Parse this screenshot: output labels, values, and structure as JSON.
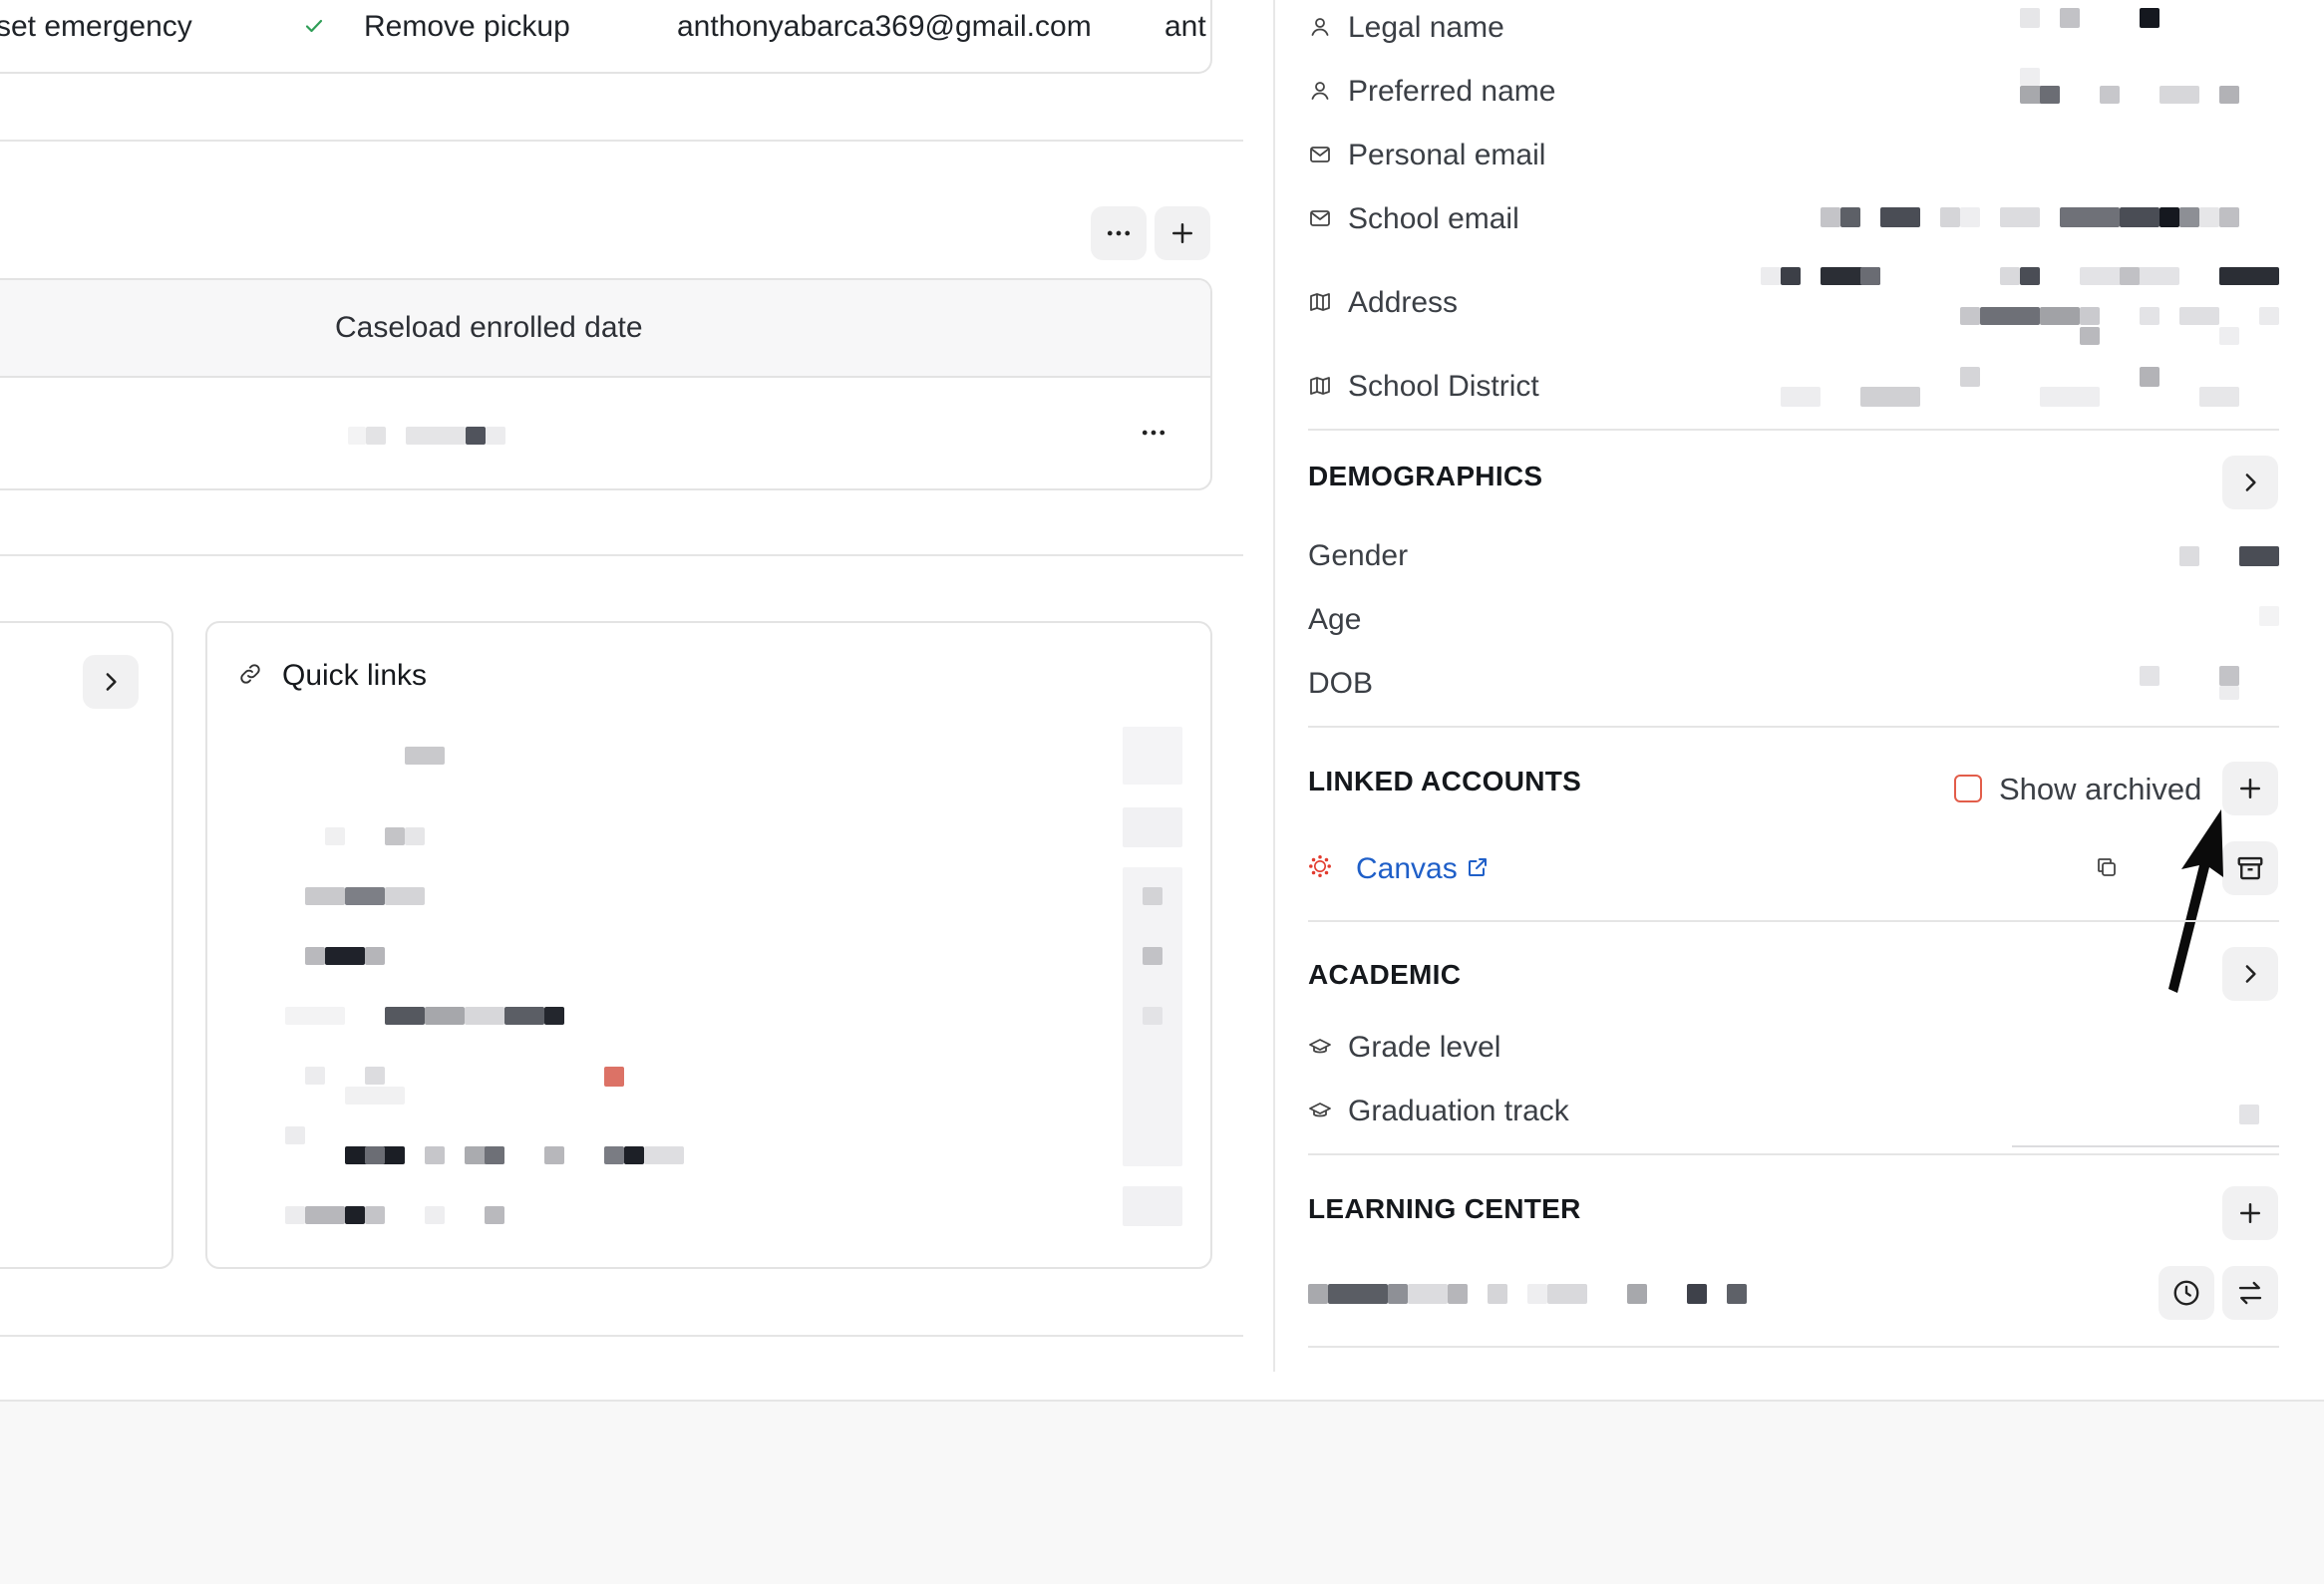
{
  "contacts_row": {
    "role": "set emergency",
    "action": "Remove pickup",
    "email": "anthonyabarca369@gmail.com",
    "truncated": "ant"
  },
  "caseload": {
    "column_header": "Caseload enrolled date"
  },
  "quick_links": {
    "title": "Quick links"
  },
  "profile": {
    "fields": [
      {
        "label": "Legal name",
        "icon": "person-icon"
      },
      {
        "label": "Preferred name",
        "icon": "person-icon"
      },
      {
        "label": "Personal email",
        "icon": "mail-icon"
      },
      {
        "label": "School email",
        "icon": "mail-icon"
      },
      {
        "label": "Address",
        "icon": "map-icon"
      },
      {
        "label": "School District",
        "icon": "map-icon"
      }
    ]
  },
  "demographics": {
    "title": "DEMOGRAPHICS",
    "fields": [
      "Gender",
      "Age",
      "DOB"
    ]
  },
  "linked_accounts": {
    "title": "LINKED ACCOUNTS",
    "show_archived_label": "Show archived",
    "account_name": "Canvas",
    "brand_color": "#e23b2e"
  },
  "academic": {
    "title": "ACADEMIC",
    "fields": [
      {
        "label": "Grade level",
        "icon": "graduation-cap-icon"
      },
      {
        "label": "Graduation track",
        "icon": "graduation-cap-icon"
      }
    ]
  },
  "learning_center": {
    "title": "LEARNING CENTER"
  }
}
